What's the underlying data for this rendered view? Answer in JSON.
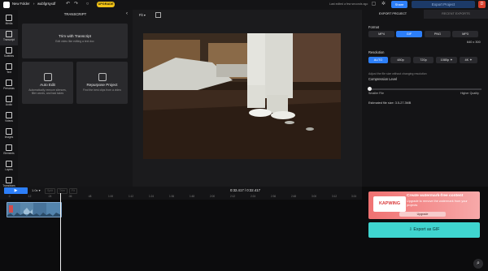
{
  "topbar": {
    "folder": "New Folder",
    "separator": "›",
    "project_name": "wubfgrsyxdf",
    "upgrade_label": "UPGRADE",
    "saved_status": "Last edited a few seconds ago",
    "share_label": "Share",
    "export_label": "Export Project",
    "avatar_initial": "D"
  },
  "rail": [
    {
      "label": "Media"
    },
    {
      "label": "Transcript"
    },
    {
      "label": "Subtitles"
    },
    {
      "label": "Text"
    },
    {
      "label": "Personas"
    },
    {
      "label": "Audio"
    },
    {
      "label": "Videos"
    },
    {
      "label": "Images"
    },
    {
      "label": "Elements"
    },
    {
      "label": "Layers"
    },
    {
      "label": "Transitions"
    }
  ],
  "transcript": {
    "title": "TRANSCRIPT",
    "trim_title": "Trim with Transcript",
    "trim_desc": "Edit video like editing a text doc",
    "auto_title": "Auto Edit",
    "auto_desc": "Automatically remove silences, filler words, and bad takes",
    "repurpose_title": "Repurpose Project",
    "repurpose_desc": "Find the best clips from a video"
  },
  "stage": {
    "fit_label": "Fit"
  },
  "export_panel": {
    "tab_export": "EXPORT PROJECT",
    "tab_recent": "RECENT EXPORTS",
    "format_label": "Format",
    "formats": [
      "MP4",
      "GIF",
      "PNG",
      "MP3"
    ],
    "selected_format": "GIF",
    "resolution_label": "Resolution",
    "resolution_value": "640 x 300",
    "resolutions": [
      "AUTO",
      "480p",
      "720p",
      "1080p ✦",
      "4K ✦"
    ],
    "selected_resolution": "AUTO",
    "compression_label": "Compression Level",
    "compression_hint": "Adjust the file size without changing resolution",
    "compression_level": 0,
    "slider_min": "Smaller File",
    "slider_max": "Higher Quality",
    "file_size": "Estimated file size: 3.5-27.3MB"
  },
  "promo": {
    "logo_text": "KAPWING",
    "title": "Create watermark-free content",
    "desc": "Upgrade to remove the watermark from your projects",
    "button": "Upgrade"
  },
  "export_gif_label": "Export as GIF",
  "timeline": {
    "play_icon": "▶",
    "speed": "1.0x",
    "buttons": [
      "Split",
      "Trim",
      "Fit"
    ],
    "time_readout": "0:32.417 / 0:32.417",
    "ticks": [
      ":0",
      ":12",
      ":24",
      ":36",
      ":48",
      "1:00",
      "1:12",
      "1:24",
      "1:36",
      "1:48",
      "2:00",
      "2:12",
      "2:24",
      "2:36",
      "2:48",
      "3:00",
      "3:12",
      "3:24"
    ]
  },
  "colors": {
    "accent": "#2d7ff9",
    "upgrade": "#f2c318",
    "export_gif": "#3fd5cf",
    "promo": "#f07272"
  }
}
